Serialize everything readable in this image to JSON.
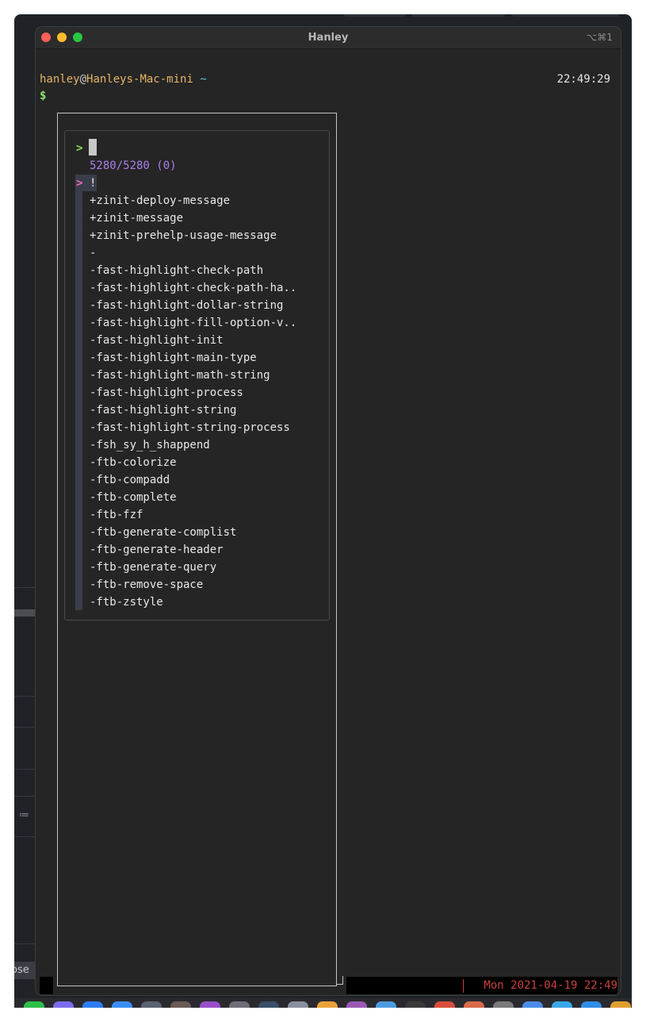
{
  "window": {
    "title": "Hanley",
    "shortcut": "⌥⌘1"
  },
  "prompt": {
    "user": "hanley",
    "at": "@",
    "host": "Hanleys-Mac-mini",
    "dir": "~",
    "clock": "22:49:29",
    "symbol": "$"
  },
  "fzf": {
    "query_pointer": ">",
    "counter": "5280/5280 (0)",
    "selected_pointer": ">",
    "selected": "!",
    "items": [
      "+zinit-deploy-message",
      "+zinit-message",
      "+zinit-prehelp-usage-message",
      "-",
      "-fast-highlight-check-path",
      "-fast-highlight-check-path-ha..",
      "-fast-highlight-dollar-string",
      "-fast-highlight-fill-option-v..",
      "-fast-highlight-init",
      "-fast-highlight-main-type",
      "-fast-highlight-math-string",
      "-fast-highlight-process",
      "-fast-highlight-string",
      "-fast-highlight-string-process",
      "-fsh_sy_h_shappend",
      "-ftb-colorize",
      "-ftb-compadd",
      "-ftb-complete",
      "-ftb-fzf",
      "-ftb-generate-complist",
      "-ftb-generate-header",
      "-ftb-generate-query",
      "-ftb-remove-space",
      "-ftb-zstyle"
    ]
  },
  "status": {
    "date": "Mon 2021-04-19 22:49"
  },
  "background": {
    "close_label": "ose",
    "list_icon": "≔"
  },
  "colors": {
    "terminal_bg": "#252525",
    "user": "#e5b567",
    "tilde": "#67c6c7",
    "prompt_symbol": "#8be36c",
    "counter": "#a981e6",
    "selected_pointer": "#ef6bc6",
    "status_text": "#c6413e"
  },
  "dock_icons": [
    "messages-icon",
    "app-icon",
    "app-icon",
    "app-icon",
    "app-icon",
    "app-icon",
    "app-icon",
    "app-icon",
    "app-icon",
    "app-icon",
    "app-icon",
    "app-icon",
    "app-icon",
    "app-icon",
    "app-icon",
    "app-icon",
    "app-icon",
    "app-icon",
    "app-icon",
    "app-icon",
    "app-icon",
    "app-icon",
    "app-icon",
    "app-icon",
    "app-icon",
    "app-icon"
  ]
}
